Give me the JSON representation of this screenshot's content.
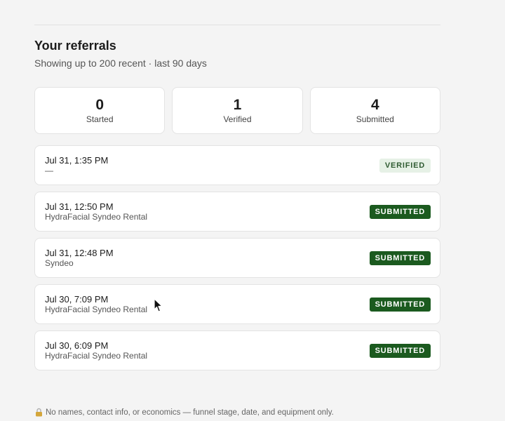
{
  "header": {
    "title": "Your referrals",
    "subtitle": "Showing up to 200 recent · last 90 days"
  },
  "stats": [
    {
      "value": "0",
      "label": "Started"
    },
    {
      "value": "1",
      "label": "Verified"
    },
    {
      "value": "4",
      "label": "Submitted"
    }
  ],
  "referrals": [
    {
      "date": "Jul 31, 1:35 PM",
      "equipment": "—",
      "status": "VERIFIED"
    },
    {
      "date": "Jul 31, 12:50 PM",
      "equipment": "HydraFacial Syndeo Rental",
      "status": "SUBMITTED"
    },
    {
      "date": "Jul 31, 12:48 PM",
      "equipment": "Syndeo",
      "status": "SUBMITTED"
    },
    {
      "date": "Jul 30, 7:09 PM",
      "equipment": "HydraFacial Syndeo Rental",
      "status": "SUBMITTED"
    },
    {
      "date": "Jul 30, 6:09 PM",
      "equipment": "HydraFacial Syndeo Rental",
      "status": "SUBMITTED"
    }
  ],
  "footer": {
    "note": "No names, contact info, or economics — funnel stage, date, and equipment only.",
    "icon": "lock-icon"
  },
  "colors": {
    "submitted_badge": "#1b5a1f",
    "verified_badge_bg": "#e6f1e6",
    "verified_badge_text": "#2f5b31",
    "background": "#f4f4f4"
  }
}
